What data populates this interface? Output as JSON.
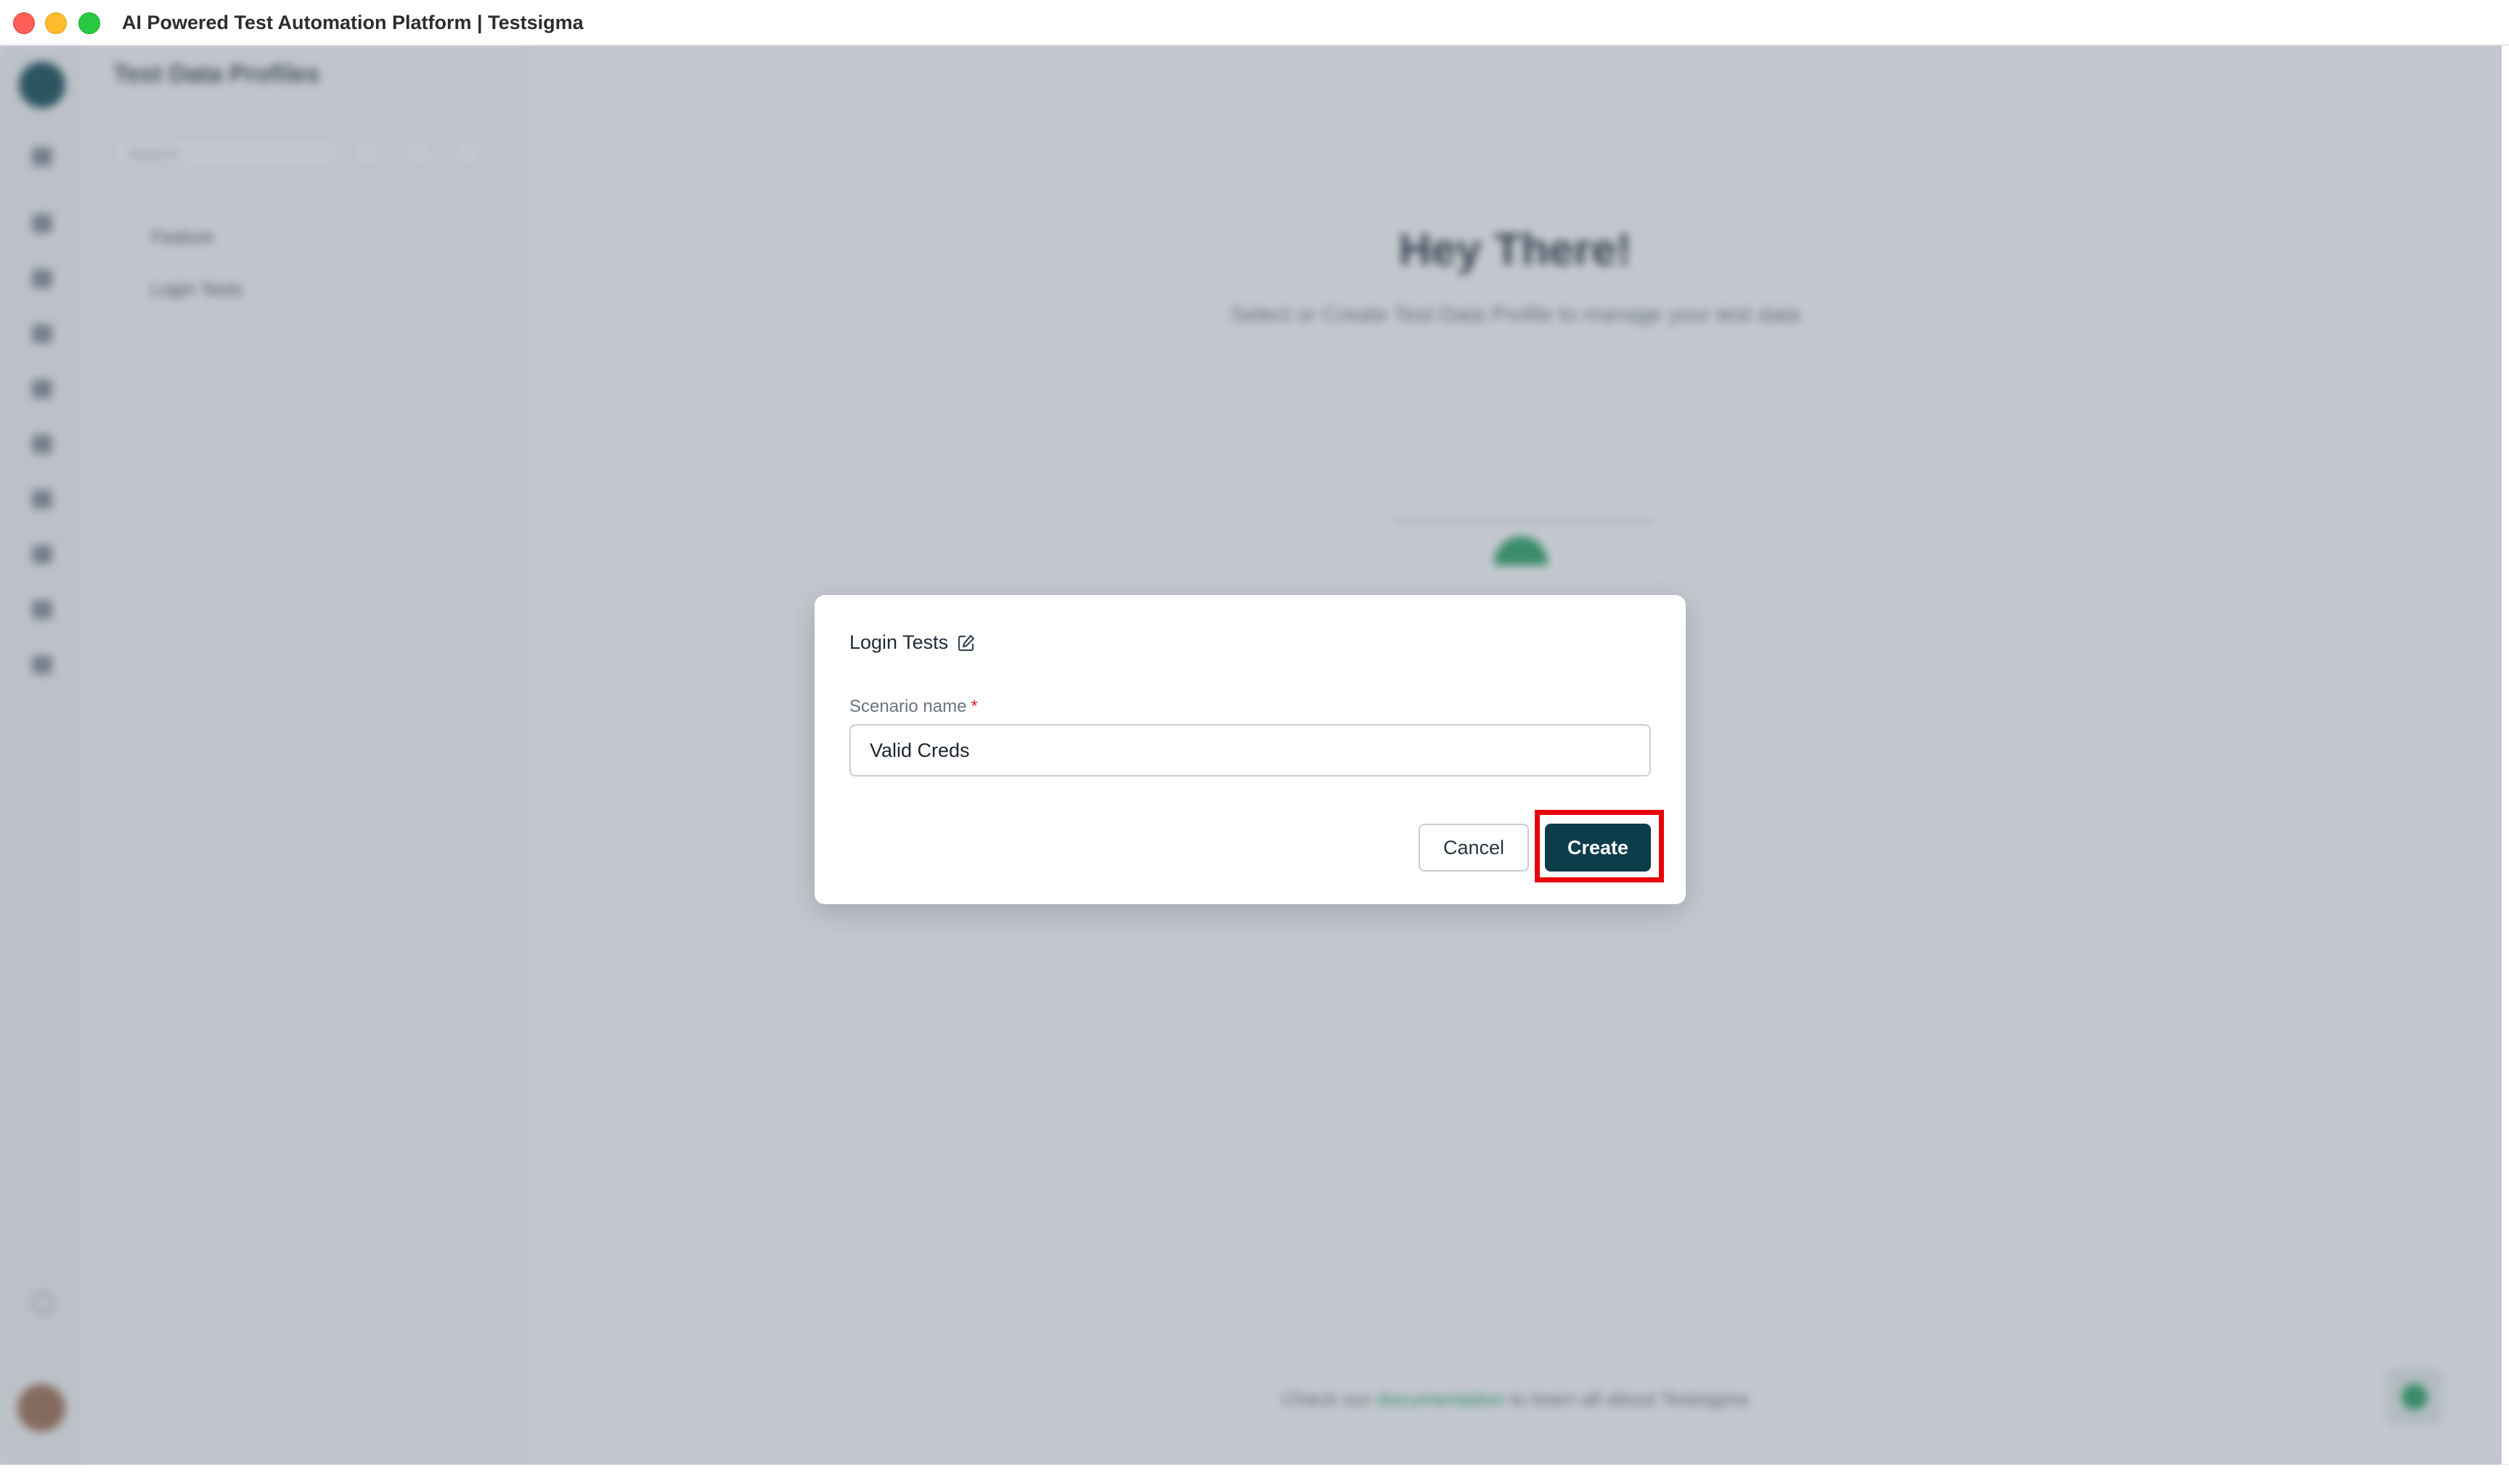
{
  "window": {
    "title": "AI Powered Test Automation Platform | Testsigma"
  },
  "sidebar_panel": {
    "title": "Test Data Profiles",
    "search_placeholder": "Search",
    "tree": [
      {
        "label": "Feature"
      },
      {
        "label": "Login Tests"
      }
    ]
  },
  "main": {
    "heading": "Hey There!",
    "subheading": "Select or Create Test Data Profile to manage your test data",
    "footer_prefix": "Check our ",
    "footer_link": "documentation",
    "footer_suffix": " to learn all about Testsigma"
  },
  "modal": {
    "title": "Login Tests",
    "field_label": "Scenario name",
    "required_mark": "*",
    "field_value": "Valid Creds",
    "cancel_label": "Cancel",
    "create_label": "Create"
  },
  "colors": {
    "primary": "#0b3d4a",
    "highlight": "#e8000b",
    "required": "#e0262e",
    "accent_green": "#22a05e"
  }
}
